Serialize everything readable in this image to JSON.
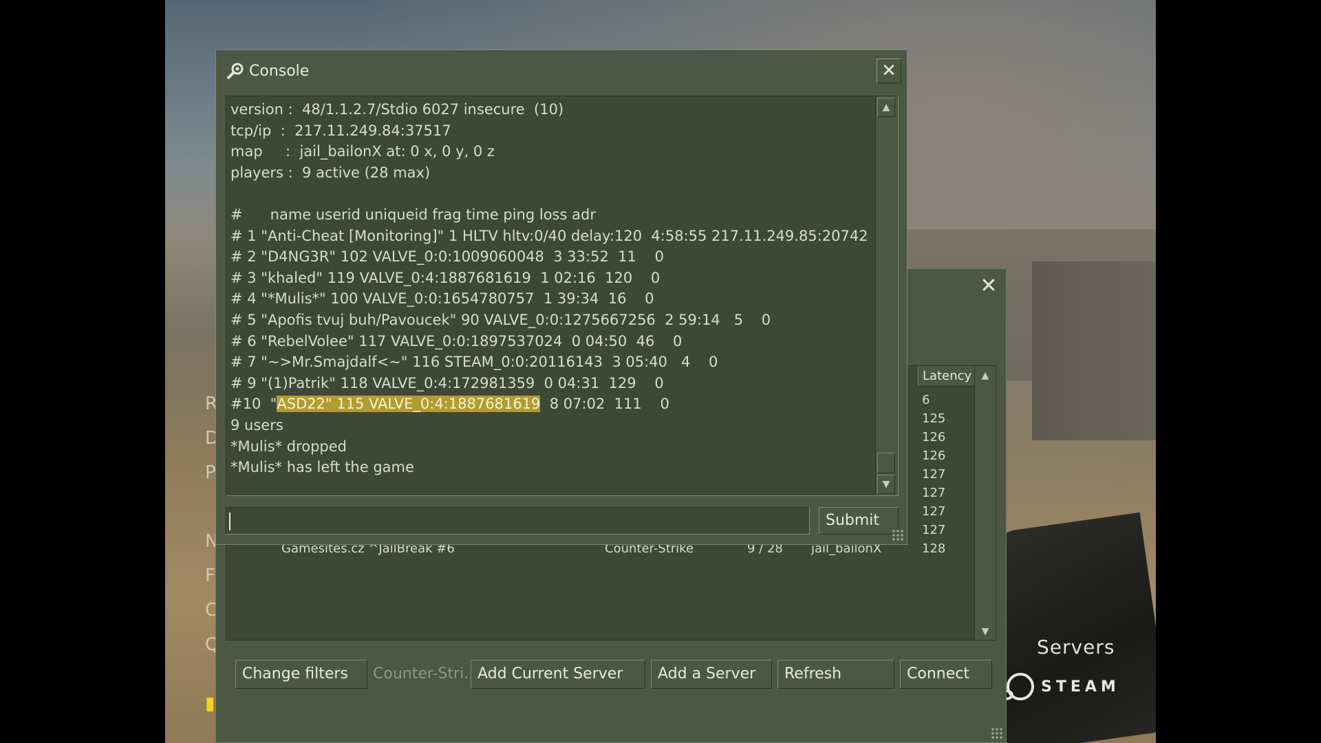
{
  "background": {
    "menu_letters": [
      "R",
      "D",
      "P",
      "N",
      "F",
      "C",
      "Q"
    ],
    "servers_label": "Servers",
    "steam_label": "STEAM"
  },
  "servers": {
    "latency_header": "Latency",
    "latencies": [
      "6",
      "125",
      "126",
      "126",
      "127",
      "127",
      "127",
      "127",
      "128"
    ],
    "last_row": {
      "name": "Gamesites.cz ^JailBreak #6",
      "game": "Counter-Strike",
      "players": "9 / 28",
      "map": "jail_bailonX"
    },
    "buttons": {
      "change_filters": "Change filters",
      "filter_text": "Counter-Stri...",
      "add_current": "Add Current Server",
      "add_server": "Add a Server",
      "refresh": "Refresh",
      "connect": "Connect"
    }
  },
  "console": {
    "title": "Console",
    "lines": [
      "version :  48/1.1.2.7/Stdio 6027 insecure  (10)",
      "tcp/ip  :  217.11.249.84:37517",
      "map     :  jail_bailonX at: 0 x, 0 y, 0 z",
      "players :  9 active (28 max)",
      "",
      "#      name userid uniqueid frag time ping loss adr",
      "# 1 \"Anti-Cheat [Monitoring]\" 1 HLTV hltv:0/40 delay:120  4:58:55 217.11.249.85:20742",
      "# 2 \"D4NG3R\" 102 VALVE_0:0:1009060048  3 33:52  11    0",
      "# 3 \"khaled\" 119 VALVE_0:4:1887681619  1 02:16  120    0",
      "# 4 \"*Mulis*\" 100 VALVE_0:0:1654780757  1 39:34  16    0",
      "# 5 \"Apofis tvuj buh/Pavoucek\" 90 VALVE_0:0:1275667256  2 59:14   5    0",
      "# 6 \"RebelVolee\" 117 VALVE_0:0:1897537024  0 04:50  46    0",
      "# 7 \"~>Mr.Smajdalf<~\" 116 STEAM_0:0:20116143  3 05:40   4    0",
      "# 9 \"(1)Patrik\" 118 VALVE_0:4:172981359  0 04:31  129    0"
    ],
    "line10_prefix": "#10  \"",
    "line10_highlight": "ASD22\" 115 VALVE_0:4:1887681619",
    "line10_suffix": "  8 07:02  111    0",
    "tail_lines": [
      "9 users",
      "*Mulis* dropped",
      "*Mulis* has left the game"
    ],
    "input_value": "",
    "submit_label": "Submit"
  }
}
